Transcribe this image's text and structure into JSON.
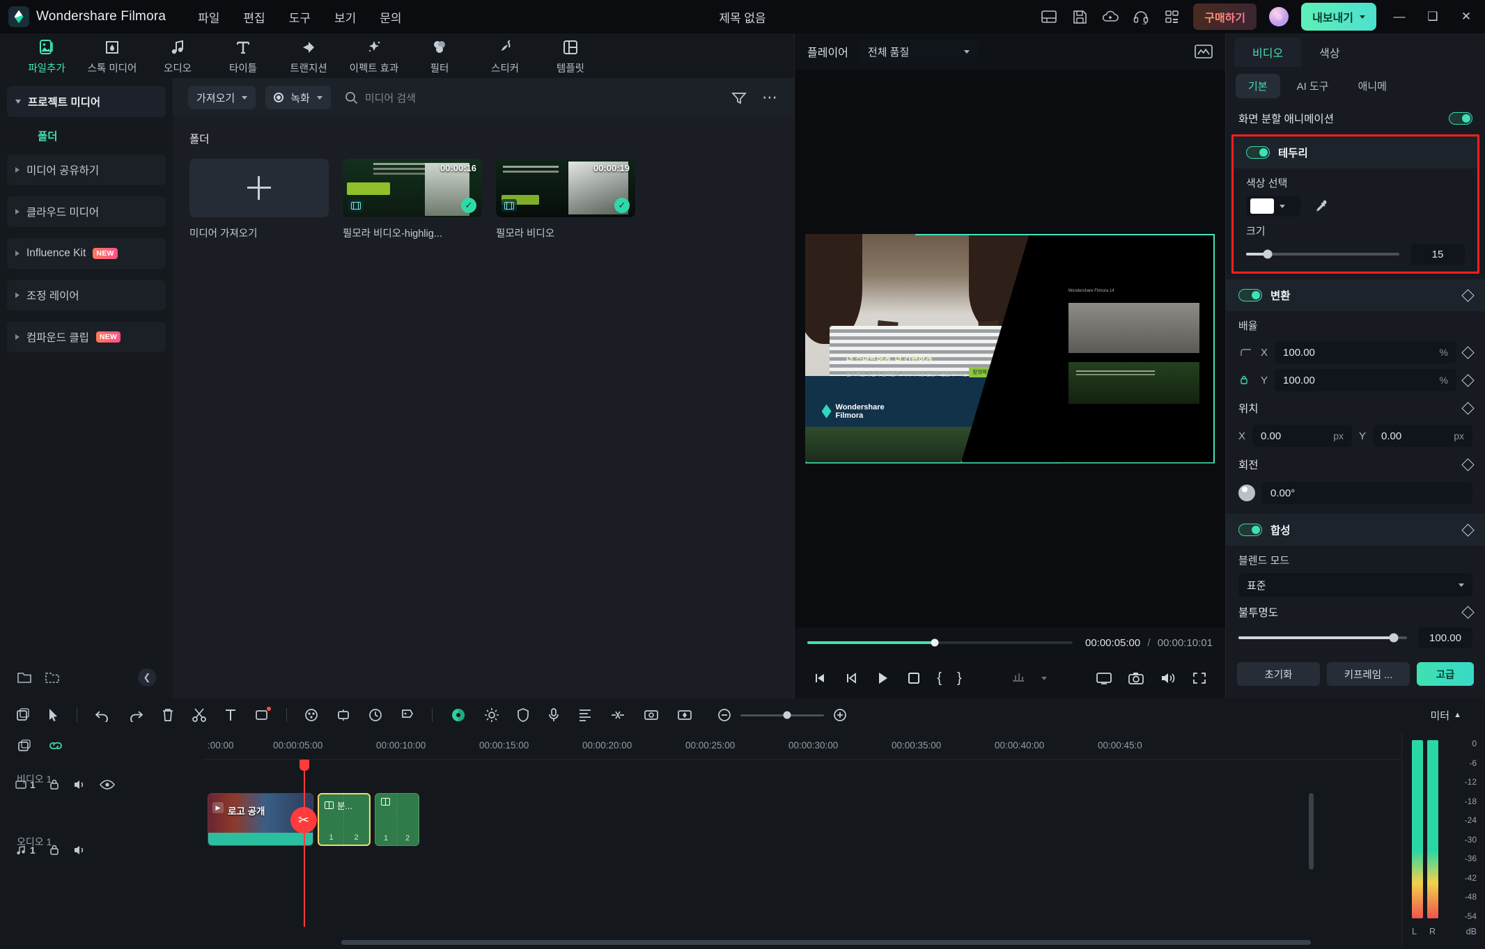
{
  "titlebar": {
    "brand": "Wondershare Filmora",
    "menus": [
      "파일",
      "편집",
      "도구",
      "보기",
      "문의"
    ],
    "document_title": "제목 없음",
    "icons": [
      "layout-icon",
      "save-icon",
      "cloud-upload-icon",
      "headset-icon",
      "grid-apps-icon"
    ],
    "buy_label": "구매하기",
    "export_label": "내보내기",
    "window_controls": [
      "minimize",
      "maximize",
      "close"
    ]
  },
  "toolbar": {
    "items": [
      {
        "label": "파일추가",
        "icon": "image-add-icon",
        "active": true
      },
      {
        "label": "스톡 미디어",
        "icon": "stock-media-icon",
        "active": false
      },
      {
        "label": "오디오",
        "icon": "music-note-icon",
        "active": false
      },
      {
        "label": "타이틀",
        "icon": "text-title-icon",
        "active": false
      },
      {
        "label": "트랜지션",
        "icon": "transition-arrows-icon",
        "active": false
      },
      {
        "label": "이펙트 효과",
        "icon": "magic-wand-icon",
        "active": false
      },
      {
        "label": "필터",
        "icon": "filter-circles-icon",
        "active": false
      },
      {
        "label": "스티커",
        "icon": "sticker-icon",
        "active": false
      },
      {
        "label": "템플릿",
        "icon": "template-grid-icon",
        "active": false
      }
    ]
  },
  "sidebar": {
    "items": [
      {
        "label": "프로젝트 미디어",
        "expanded": true,
        "badge": null
      },
      {
        "label": "폴더",
        "is_folder_label": true,
        "badge": null
      },
      {
        "label": "미디어 공유하기",
        "expanded": false,
        "badge": null
      },
      {
        "label": "클라우드 미디어",
        "expanded": false,
        "badge": null
      },
      {
        "label": "Influence Kit",
        "expanded": false,
        "badge": "NEW"
      },
      {
        "label": "조정 레이어",
        "expanded": false,
        "badge": null
      },
      {
        "label": "컴파운드 클립",
        "expanded": false,
        "badge": "NEW"
      }
    ],
    "bottom_icons": [
      "new-folder-icon",
      "folder-move-icon",
      "collapse-icon"
    ]
  },
  "media_browser": {
    "import_label": "가져오기",
    "record_label": "녹화",
    "search_placeholder": "미디어 검색",
    "right_icons": [
      "filter-sort-icon",
      "more-options-icon"
    ],
    "section_title": "폴더",
    "items": [
      {
        "caption": "미디어 가져오기",
        "type": "add",
        "duration": null,
        "selected": false
      },
      {
        "caption": "필모라 비디오-highlig...",
        "type": "video",
        "duration": "00:00:16",
        "selected": true
      },
      {
        "caption": "필모라 비디오",
        "type": "video",
        "duration": "00:00:19",
        "selected": true
      }
    ]
  },
  "player": {
    "title": "플레이어",
    "quality": "전체 품질",
    "snapshot_icon": "waveform-icon",
    "current_time": "00:00:05:00",
    "separator": "/",
    "total_time": "00:00:10:01",
    "controls": [
      "prev-frame",
      "step-back",
      "play",
      "stop",
      "mark-in",
      "mark-out",
      "speed",
      "speed-chevron",
      "screen-cast",
      "snapshot-camera",
      "volume",
      "fullscreen"
    ],
    "preview_text": {
      "headline": "더 스마트하게, 더 간편하게",
      "sub": "쉽고 빠른 수준과 실력별로, 아이디어를 현실로 만들어드리는 새로운 AI 기능",
      "tag": "창의력을 구현",
      "brand_top": "Wondershare",
      "brand_bottom": "Filmora",
      "brand_small": "Wondershare Filmora 14"
    }
  },
  "properties": {
    "tabs": [
      {
        "label": "비디오",
        "active": true
      },
      {
        "label": "색상",
        "active": false
      }
    ],
    "segments": [
      {
        "label": "기본",
        "active": true
      },
      {
        "label": "AI 도구",
        "active": false
      },
      {
        "label": "애니메",
        "active": false
      }
    ],
    "split_animation": {
      "label": "화면 분할 애니메이션",
      "enabled": true
    },
    "border": {
      "label": "테두리",
      "enabled": true,
      "highlighted": true,
      "color_label": "색상 선택",
      "color_value": "#FFFFFF",
      "eyedropper_icon": "eyedropper-icon",
      "size_label": "크기",
      "size_value": "15",
      "size_percent": 14
    },
    "transform": {
      "label": "변환",
      "enabled": true,
      "scale_label": "배율",
      "scale_x_axis": "X",
      "scale_x": "100.00",
      "scale_y_axis": "Y",
      "scale_y": "100.00",
      "scale_unit": "%",
      "position_label": "위치",
      "pos_x_axis": "X",
      "pos_x": "0.00",
      "pos_y_axis": "Y",
      "pos_y": "0.00",
      "pos_unit": "px",
      "rotation_label": "회전",
      "rotation": "0.00°"
    },
    "composite": {
      "label": "합성",
      "enabled": true,
      "blend_label": "블렌드 모드",
      "blend_value": "표준",
      "opacity_label": "불투명도",
      "opacity_value": "100.00",
      "opacity_percent": 92
    },
    "footer": {
      "reset": "초기화",
      "keyframe": "키프레임 ...",
      "advanced": "고급"
    }
  },
  "timeline": {
    "tools": [
      "import-media-icon",
      "pointer-icon",
      "undo-icon",
      "redo-icon",
      "delete-icon",
      "split-scissors-icon",
      "text-icon",
      "crop-icon",
      "color-match-icon",
      "auto-reframe-icon",
      "speed-icon",
      "marker-icon",
      "mask-icon",
      "green-screen-icon",
      "adjust-icon",
      "shield-icon",
      "mic-icon",
      "audio-edit-icon",
      "detach-audio-icon",
      "motion-tracking-icon",
      "keyframe-icon",
      "zoom-out-icon",
      "zoom-in-icon"
    ],
    "meter_label": "미터",
    "left_icons": [
      "layer-icon",
      "link-icon"
    ],
    "ruler_ticks": [
      ":00:00",
      "00:00:05:00",
      "00:00:10:00",
      "00:00:15:00",
      "00:00:20:00",
      "00:00:25:00",
      "00:00:30:00",
      "00:00:35:00",
      "00:00:40:00",
      "00:00:45:0"
    ],
    "tracks": [
      {
        "index": "1",
        "name": "비디오 1",
        "type": "video",
        "icons": [
          "lock-icon",
          "mute-icon",
          "eye-icon"
        ]
      },
      {
        "index": "1",
        "name": "오디오 1",
        "type": "audio",
        "icons": [
          "lock-icon",
          "mute-icon"
        ]
      }
    ],
    "clips": [
      {
        "label": "로고 공개",
        "type": "video",
        "selected": false
      },
      {
        "label": "분...",
        "type": "split-screen",
        "selected": true,
        "sub_numbers": [
          "1",
          "2"
        ]
      },
      {
        "label": "",
        "type": "split-screen",
        "selected": false,
        "sub_numbers": [
          "1",
          "2"
        ]
      }
    ],
    "meter_scale": [
      "0",
      "-6",
      "-12",
      "-18",
      "-24",
      "-30",
      "-36",
      "-42",
      "-48",
      "-54"
    ],
    "meter_lr": [
      "L",
      "R"
    ],
    "meter_unit": "dB"
  }
}
